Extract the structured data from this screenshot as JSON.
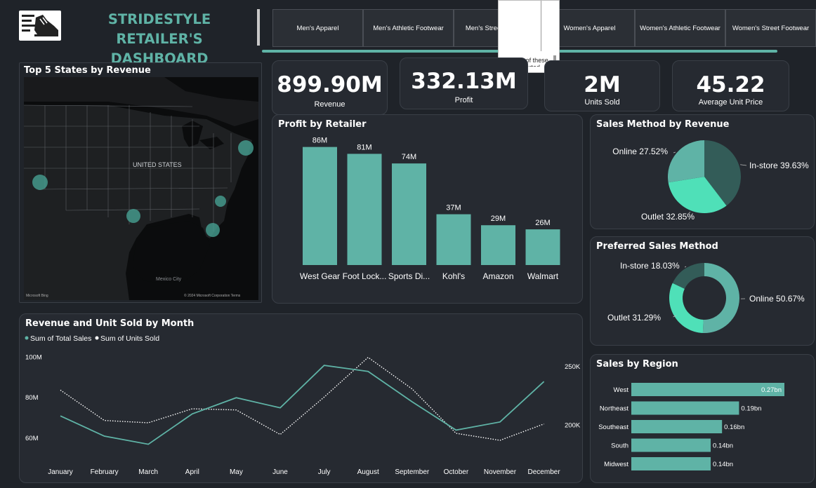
{
  "header": {
    "title": "STRIDESTYLE RETAILER'S DASHBOARD",
    "logo_icon": "sneaker-icon"
  },
  "tabs": [
    {
      "label": "Men's Apparel"
    },
    {
      "label": "Men's Athletic Footwear"
    },
    {
      "label": "Men's Street Footwear"
    },
    {
      "label": "Women's Apparel"
    },
    {
      "label": "Women's Athletic Footwear"
    },
    {
      "label": "Women's Street Footwear"
    }
  ],
  "tooltip": {
    "line1": "Try one of these",
    "line2": "or get started"
  },
  "kpis": [
    {
      "value": "899.90M",
      "label": "Revenue"
    },
    {
      "value": "332.13M",
      "label": "Profit"
    },
    {
      "value": "2M",
      "label": "Units Sold"
    },
    {
      "value": "45.22",
      "label": "Average Unit Price"
    }
  ],
  "map": {
    "title": "Top 5 States by Revenue",
    "country_label": "UNITED STATES",
    "attribution_left": "Microsoft Bing",
    "attribution_right": "© 2024 Microsoft Corporation Terms",
    "city_label": "Mexico City",
    "bubble_color": "#4aa89a"
  },
  "colors": {
    "accent": "#5fb3a6",
    "accent_bright": "#4fe0b8",
    "dark_slice": "#335c58",
    "card": "#262a31"
  },
  "profit_chart": {
    "title": "Profit by Retailer",
    "chart_data": {
      "type": "bar",
      "categories": [
        "West Gear",
        "Foot Lock...",
        "Sports Di...",
        "Kohl's",
        "Amazon",
        "Walmart"
      ],
      "values": [
        86,
        81,
        74,
        37,
        29,
        26
      ],
      "value_labels": [
        "86M",
        "81M",
        "74M",
        "37M",
        "29M",
        "26M"
      ],
      "ylim": [
        0,
        95
      ]
    }
  },
  "sales_method_chart": {
    "title": "Sales Method by Revenue",
    "chart_data": {
      "type": "pie",
      "categories": [
        "In-store",
        "Outlet",
        "Online"
      ],
      "values": [
        39.63,
        32.85,
        27.52
      ],
      "labels": [
        "In-store 39.63%",
        "Outlet 32.85%",
        "Online 27.52%"
      ],
      "colors": [
        "#335c58",
        "#4fe0b8",
        "#5fb3a6"
      ]
    }
  },
  "preferred_method_chart": {
    "title": "Preferred Sales Method",
    "chart_data": {
      "type": "pie",
      "categories": [
        "Online",
        "Outlet",
        "In-store"
      ],
      "values": [
        50.67,
        31.29,
        18.03
      ],
      "labels": [
        "Online 50.67%",
        "Outlet 31.29%",
        "In-store 18.03%"
      ],
      "colors": [
        "#5fb3a6",
        "#4fe0b8",
        "#335c58"
      ]
    }
  },
  "region_chart": {
    "title": "Sales by Region",
    "chart_data": {
      "type": "bar",
      "categories": [
        "West",
        "Northeast",
        "Southeast",
        "South",
        "Midwest"
      ],
      "values": [
        0.27,
        0.19,
        0.16,
        0.14,
        0.14
      ],
      "value_labels": [
        "0.27bn",
        "0.19bn",
        "0.16bn",
        "0.14bn",
        "0.14bn"
      ],
      "xlim": [
        0,
        0.27
      ]
    }
  },
  "monthly_chart": {
    "title": "Revenue and Unit Sold by Month",
    "chart_data": {
      "type": "line",
      "categories": [
        "January",
        "February",
        "March",
        "April",
        "May",
        "June",
        "July",
        "August",
        "September",
        "October",
        "November",
        "December"
      ],
      "series": [
        {
          "name": "Sum of Total Sales",
          "values": [
            71,
            61,
            57,
            72,
            80,
            75,
            96,
            93,
            78,
            64,
            68,
            88
          ],
          "axis": "left",
          "style": "solid"
        },
        {
          "name": "Sum of Units Sold",
          "values": [
            230,
            204,
            202,
            214,
            213,
            192,
            224,
            258,
            231,
            193,
            187,
            201
          ],
          "axis": "right",
          "style": "dotted"
        }
      ],
      "left_ticks": [
        "100M",
        "80M",
        "60M"
      ],
      "right_ticks": [
        "250K",
        "200K"
      ],
      "left_ylim": [
        52,
        104
      ],
      "right_ylim": [
        175,
        265
      ]
    }
  }
}
